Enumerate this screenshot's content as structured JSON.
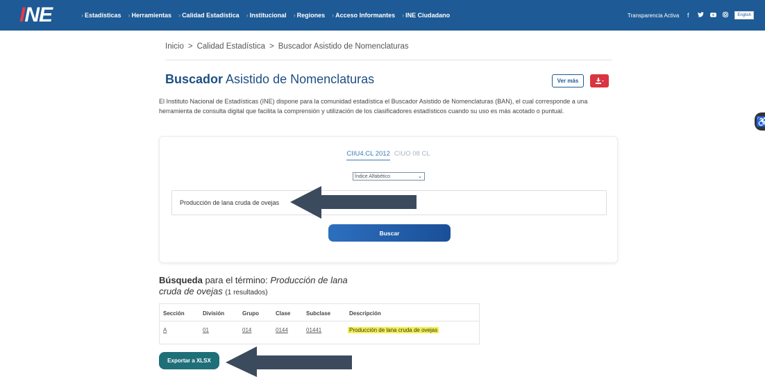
{
  "header": {
    "logo_text": "INE",
    "nav": [
      "Estadísticas",
      "Herramientas",
      "Calidad Estadística",
      "Institucional",
      "Regiones",
      "Acceso Informantes",
      "INE Ciudadano"
    ],
    "transparency": "Transparencia Activa",
    "social_icons": [
      "facebook-icon",
      "twitter-icon",
      "youtube-icon",
      "instagram-icon"
    ],
    "language": "English"
  },
  "breadcrumb": [
    "Inicio",
    "Calidad Estadística",
    "Buscador Asistido de Nomenclaturas"
  ],
  "breadcrumb_sep": ">",
  "page": {
    "title_bold": "Buscador",
    "title_rest": " Asistido de Nomenclaturas",
    "ver_mas": "Ver más",
    "description": "El Instituto Nacional de Estadísticas (INE) dispone para la comunidad estadística el Buscador Asistido de Nomenclaturas (BAN), el cual corresponde a una herramienta de consulta digital que facilita la comprensión y utilización de los clasificadores estadísticos cuando su uso es más acotado o puntual."
  },
  "search": {
    "tabs": [
      "CIIU4.CL 2012",
      "CIUO 08 CL"
    ],
    "active_tab": 0,
    "select_value": "Índice Alfabético",
    "input_value": "Producción de lana cruda de ovejas",
    "button": "Buscar"
  },
  "results": {
    "label_bold": "Búsqueda",
    "label_mid": " para el término: ",
    "term": "Producción de lana cruda de ovejas",
    "count": "(1 resultados)",
    "columns": [
      "Sección",
      "División",
      "Grupo",
      "Clase",
      "Subclase",
      "Descripción"
    ],
    "rows": [
      [
        "A",
        "01",
        "014",
        "0144",
        "01441",
        "Producción de lana cruda de ovejas"
      ]
    ],
    "export_button": "Exportar a XLSX"
  },
  "colors": {
    "nav_blue": "#1d5a96",
    "accent_red": "#d9343f",
    "export_teal": "#1f6f79",
    "arrow": "#3c4a5e",
    "highlight": "#f4f14a"
  }
}
